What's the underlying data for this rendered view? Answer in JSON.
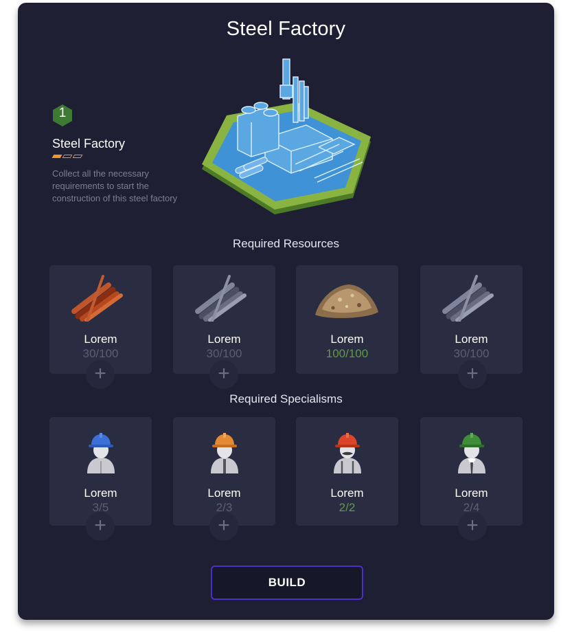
{
  "panel": {
    "title": "Steel Factory"
  },
  "building": {
    "level": "1",
    "name": "Steel Factory",
    "tiers_filled": 1,
    "tiers_total": 3,
    "description": "Collect all the necessary requirements to start the construction of this steel factory"
  },
  "resources": {
    "title": "Required Resources",
    "items": [
      {
        "label": "Lorem",
        "count": "30/100",
        "icon": "copper-rods-icon"
      },
      {
        "label": "Lorem",
        "count": "30/100",
        "icon": "steel-rods-icon"
      },
      {
        "label": "Lorem",
        "count": "100/100",
        "icon": "sand-pile-icon"
      },
      {
        "label": "Lorem",
        "count": "30/100",
        "icon": "steel-rods-icon"
      }
    ]
  },
  "specialisms": {
    "title": "Required Specialisms",
    "items": [
      {
        "label": "Lorem",
        "count": "3/5",
        "icon": "worker-blue-helmet-icon",
        "helmet": "#3d6fd8"
      },
      {
        "label": "Lorem",
        "count": "2/3",
        "icon": "worker-orange-helmet-icon",
        "helmet": "#e38a34"
      },
      {
        "label": "Lorem",
        "count": "2/2",
        "icon": "worker-red-helmet-icon",
        "helmet": "#d9462a"
      },
      {
        "label": "Lorem",
        "count": "2/4",
        "icon": "worker-green-helmet-icon",
        "helmet": "#3f8f3a"
      }
    ]
  },
  "build_button": {
    "label": "BUILD"
  },
  "colors": {
    "panel": "#1e1f33",
    "card": "#2a2c42",
    "accent": "#4c2ec9",
    "complete": "#5e9c43",
    "tier": "#f0952c"
  }
}
